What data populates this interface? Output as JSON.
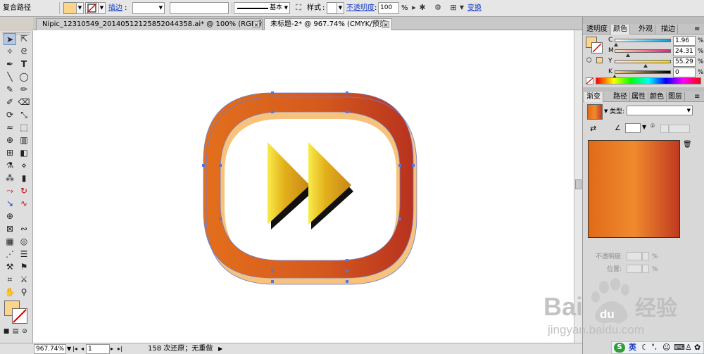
{
  "control_bar": {
    "path_label": "复合路径",
    "fill_color": "#fdd58a",
    "stroke_link": "描边",
    "stroke_weight": "",
    "brush_field": "",
    "profile_label": "基本",
    "style_label": "样式",
    "opacity_link": "不透明度",
    "opacity_value": "100",
    "opacity_unit": "%",
    "transform_link": "变换"
  },
  "tabs": [
    {
      "label": "Nipic_12310549_20140512125852044358.ai* @ 100% (RGB/轮廓)",
      "active": false
    },
    {
      "label": "未标题-2* @ 967.74% (CMYK/预览)",
      "active": true
    }
  ],
  "status_bar": {
    "zoom": "967.74%",
    "page": "1",
    "history": "158 次还原；无重做"
  },
  "color_panel": {
    "tabs": [
      "透明度",
      "颜色",
      "外观",
      "描边"
    ],
    "active_tab": 1,
    "fill": "#fdd58a",
    "channels": [
      {
        "name": "C",
        "value": "1.96",
        "fraction": 0.02
      },
      {
        "name": "M",
        "value": "24.31",
        "fraction": 0.243
      },
      {
        "name": "Y",
        "value": "55.29",
        "fraction": 0.553
      },
      {
        "name": "K",
        "value": "0",
        "fraction": 0
      }
    ],
    "unit": "%"
  },
  "gradient_panel": {
    "tabs": [
      "渐变",
      "路径",
      "属性",
      "颜色",
      "图层"
    ],
    "active_tab": 0,
    "type_label": "类型:",
    "type_value": "",
    "angle_value": "",
    "opacity_label": "不透明度:",
    "position_label": "位置:",
    "unit": "%",
    "stops": [
      "#e06a18",
      "#f08a2e",
      "#c03a20"
    ]
  },
  "artwork": {
    "frame_gradient": [
      "#e36f1c",
      "#d55a1e",
      "#b8321e"
    ],
    "frame_back": "#f6c27c",
    "triangle_gradient": [
      "#f9ec4a",
      "#e2b01a",
      "#c8861a"
    ],
    "shadow": "#111111"
  },
  "watermark": {
    "brand": "Bai",
    "brand_suffix": "经验",
    "du": "du",
    "url": "jingyan.baidu.com"
  },
  "tray": {
    "ime_label": "英"
  }
}
